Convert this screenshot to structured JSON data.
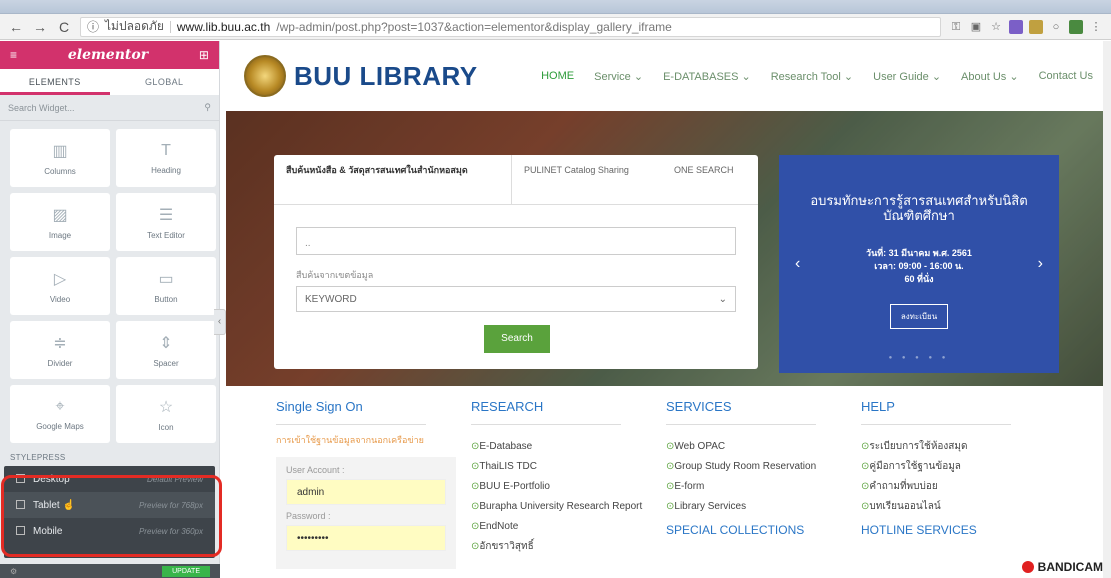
{
  "browser": {
    "address_prefix": "ไม่ปลอดภัย",
    "host": "www.lib.buu.ac.th",
    "path": "/wp-admin/post.php?post=1037&action=elementor&display_gallery_iframe"
  },
  "panel": {
    "logo": "elementor",
    "tabs": [
      "ELEMENTS",
      "GLOBAL"
    ],
    "search_placeholder": "Search Widget...",
    "widgets": [
      {
        "label": "Columns",
        "icon": "columns-icon"
      },
      {
        "label": "Heading",
        "icon": "heading-icon"
      },
      {
        "label": "Image",
        "icon": "image-icon"
      },
      {
        "label": "Text Editor",
        "icon": "text-editor-icon"
      },
      {
        "label": "Video",
        "icon": "video-icon"
      },
      {
        "label": "Button",
        "icon": "button-icon"
      },
      {
        "label": "Divider",
        "icon": "divider-icon"
      },
      {
        "label": "Spacer",
        "icon": "spacer-icon"
      },
      {
        "label": "Google Maps",
        "icon": "map-icon"
      },
      {
        "label": "Icon",
        "icon": "star-icon"
      }
    ],
    "stylepress_title": "STYLEPRESS",
    "devices": [
      {
        "label": "Desktop",
        "hint": "Default Preview"
      },
      {
        "label": "Tablet",
        "hint": "Preview for 768px"
      },
      {
        "label": "Mobile",
        "hint": "Preview for 360px"
      }
    ],
    "update_label": "UPDATE"
  },
  "site": {
    "brand": "BUU LIBRARY",
    "menu": [
      "HOME",
      "Service ⌄",
      "E-DATABASES ⌄",
      "Research Tool ⌄",
      "User Guide ⌄",
      "About Us ⌄",
      "Contact Us"
    ],
    "search": {
      "tabs": [
        "สืบค้นหนังสือ & วัสดุสารสนเทศในสำนักหอสมุด",
        "PULINET Catalog Sharing",
        "ONE SEARCH"
      ],
      "input_value": "..",
      "collection_label": "สืบค้นจากเขตข้อมูล",
      "select_value": "KEYWORD",
      "button": "Search"
    },
    "banner": {
      "title": "อบรมทักษะการรู้สารสนเทศสำหรับนิสิตบัณฑิตศึกษา",
      "date": "วันที่: 31 มีนาคม พ.ศ. 2561",
      "time": "เวลา: 09:00 - 16:00 น.",
      "seats": "60 ที่นั่ง",
      "button": "ลงทะเบียน"
    },
    "sso": {
      "title": "Single Sign On",
      "login_link": "การเข้าใช้ฐานข้อมูลจากนอกเครือข่าย",
      "user_label": "User Account :",
      "user_value": "admin",
      "password_label": "Password :",
      "password_value": "•••••••••"
    },
    "research": {
      "title": "RESEARCH",
      "items": [
        "E-Database",
        "ThaiLIS TDC",
        "BUU E-Portfolio",
        "Burapha University Research Report",
        "EndNote",
        "อักขราวิสุทธิ์"
      ]
    },
    "services": {
      "title": "SERVICES",
      "items": [
        "Web OPAC",
        "Group Study Room Reservation",
        "E-form",
        "Library Services"
      ],
      "subtitle": "SPECIAL COLLECTIONS"
    },
    "help": {
      "title": "HELP",
      "items": [
        "ระเบียบการใช้ห้องสมุด",
        "คู่มือการใช้ฐานข้อมูล",
        "คำถามที่พบบ่อย",
        "บทเรียนออนไลน์"
      ],
      "subtitle": "HOTLINE SERVICES"
    },
    "watermark": "BANDICAM"
  }
}
